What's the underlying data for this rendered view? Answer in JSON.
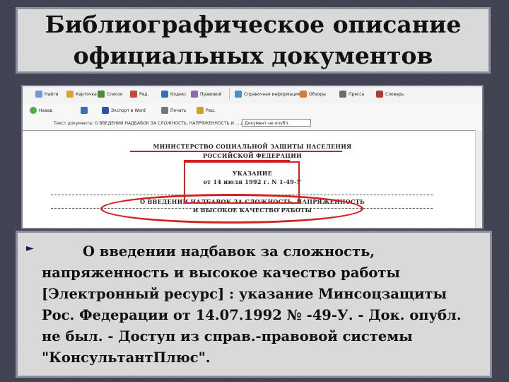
{
  "slide": {
    "title_line1": "Библиографическое описание",
    "title_line2": "официальных документов",
    "bullet_symbol": "►",
    "description": "О введении надбавок за сложность, напряженность и высокое качество работы [Электронный ресурс] : указание Минсоцзащиты Рос. Федерации от 14.07.1992 № -49-У. - Док. опубл. не был. - Доступ из справ.-правовой системы \"КонсультантПлюс\"."
  },
  "screenshot": {
    "toolbar1": {
      "items": [
        "Найти",
        "Карточка",
        "Список",
        "Ред.",
        "Кодекс",
        "Правовой"
      ],
      "items_right": [
        "Справочная информация",
        "Обзоры",
        "Пресса",
        "Словарь"
      ]
    },
    "toolbar2": {
      "back_label": "Назад",
      "items": [
        "Экспорт в Word",
        "Печать",
        "Ред."
      ]
    },
    "toolbar3": {
      "path_text": "Текст документа: О ВВЕДЕНИИ НАДБАВОК ЗА СЛОЖНОСТЬ, НАПРЯЖЕННОСТЬ И ... Док. опубл. не был.",
      "combo_value": "Документ не опубл."
    },
    "document": {
      "ministry_line1": "МИНИСТЕРСТВО СОЦИАЛЬНОЙ ЗАЩИТЫ НАСЕЛЕНИЯ",
      "ministry_line2": "РОССИЙСКОЙ ФЕДЕРАЦИИ",
      "doc_type": "УКАЗАНИЕ",
      "doc_date_number": "от 14 июля 1992 г. N 1-49-У",
      "heading_line1": "О ВВЕДЕНИИ НАДБАВОК ЗА СЛОЖНОСТЬ, НАПРЯЖЕННОСТЬ",
      "heading_line2": "И ВЫСОКОЕ КАЧЕСТВО РАБОТЫ"
    }
  },
  "colors": {
    "background": "#3e4050",
    "box_fill": "#d9d9d9",
    "box_border": "#8c8ea0",
    "highlight_red": "#d42020",
    "bullet": "#1a1a60"
  }
}
